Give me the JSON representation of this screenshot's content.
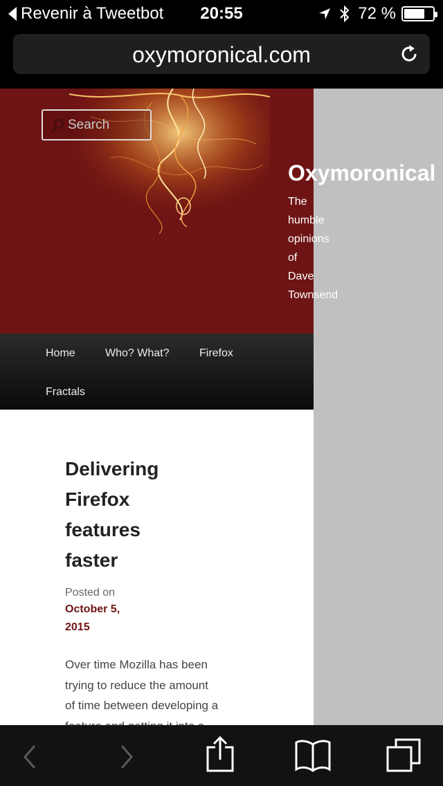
{
  "status_bar": {
    "back_label": "Revenir à Tweetbot",
    "time": "20:55",
    "battery_percent": "72 %",
    "battery_level": 0.72
  },
  "browser": {
    "url": "oxymoronical.com"
  },
  "site": {
    "search_placeholder": "Search",
    "title": "Oxymoronical",
    "description_lines": [
      "The",
      "humble",
      "opinions",
      "of",
      "Dave",
      "Townsend"
    ],
    "nav": [
      "Home",
      "Who? What?",
      "Firefox",
      "Fractals"
    ]
  },
  "article": {
    "title_lines": [
      "Delivering",
      "Firefox",
      "features",
      "faster"
    ],
    "posted_on": "Posted on",
    "date_lines": [
      "October 5,",
      "2015"
    ],
    "excerpt_lines": [
      "Over time Mozilla has been",
      "trying to reduce the amount",
      "of time between developing a",
      "feature and getting it into a"
    ]
  },
  "colors": {
    "header_bg": "#6f1414",
    "accent": "#6f1414",
    "sidebar_gray": "#c0c0c0"
  }
}
